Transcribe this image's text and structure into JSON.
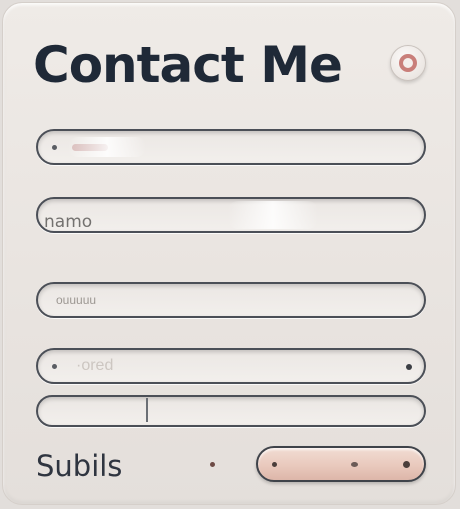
{
  "form": {
    "title": "Contact Me",
    "menu_icon": "circle-ring-icon",
    "fields": [
      {
        "name": "field-1",
        "value": ""
      },
      {
        "name": "field-2",
        "value": "namo"
      },
      {
        "name": "field-3",
        "value": "ouuuuu"
      },
      {
        "name": "field-4",
        "value": "·ored"
      },
      {
        "name": "field-5",
        "value": ""
      }
    ],
    "submit_label": "Subils",
    "submit_button_label": ""
  },
  "colors": {
    "title": "#1f2937",
    "background": "#e9e4e0",
    "field_border": "#4b4f57",
    "button_fill": "#e9c9bd",
    "accent_ring": "#c97f7a"
  }
}
